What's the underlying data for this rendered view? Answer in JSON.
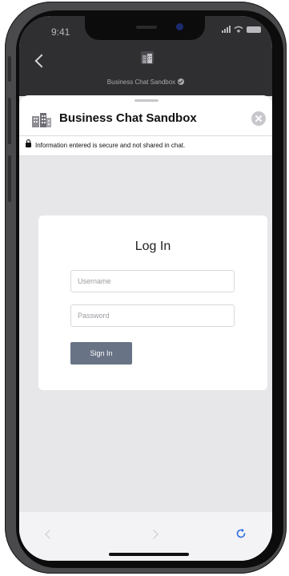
{
  "status_bar": {
    "time": "9:41"
  },
  "nav_bar": {
    "title": "Business Chat Sandbox"
  },
  "sheet": {
    "title": "Business Chat Sandbox",
    "security_notice": "Information entered is secure and not shared in chat."
  },
  "login_form": {
    "title": "Log In",
    "username_placeholder": "Username",
    "password_placeholder": "Password",
    "signin_label": "Sign In"
  },
  "colors": {
    "nav_background": "#2f2f31",
    "signin_button": "#687385",
    "sheet_background": "#e7e7ea",
    "reload_icon": "#2f6fe0"
  },
  "icons": [
    "back-chevron-icon",
    "building-icon",
    "verified-icon",
    "close-icon",
    "lock-icon",
    "browser-back-icon",
    "browser-forward-icon",
    "reload-icon"
  ]
}
